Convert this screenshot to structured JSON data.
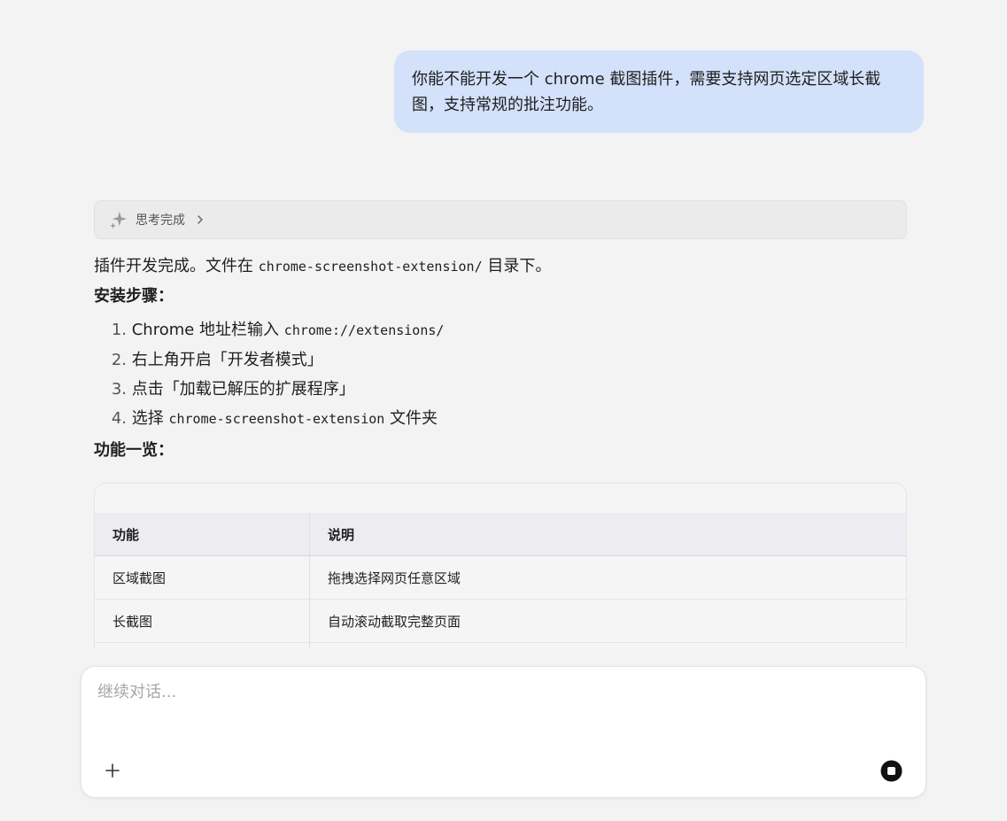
{
  "conversation": {
    "user_message": "你能不能开发一个 chrome 截图插件，需要支持网页选定区域长截图，支持常规的批注功能。",
    "assistant": {
      "thinking_label": "思考完成",
      "intro_prefix": "插件开发完成。文件在",
      "intro_code": "chrome-screenshot-extension/",
      "intro_suffix": "目录下。",
      "install_heading": "安装步骤：",
      "steps": [
        {
          "num": "1.",
          "text": "Chrome 地址栏输入",
          "code": "chrome://extensions/",
          "after": ""
        },
        {
          "num": "2.",
          "text": "右上角开启「开发者模式」",
          "code": "",
          "after": ""
        },
        {
          "num": "3.",
          "text": "点击「加载已解压的扩展程序」",
          "code": "",
          "after": ""
        },
        {
          "num": "4.",
          "text": "选择",
          "code": "chrome-screenshot-extension",
          "after": "文件夹"
        }
      ],
      "features_heading": "功能一览：",
      "table": {
        "headers": [
          "功能",
          "说明"
        ],
        "rows": [
          [
            "区域截图",
            "拖拽选择网页任意区域"
          ],
          [
            "长截图",
            "自动滚动截取完整页面"
          ]
        ]
      }
    }
  },
  "composer": {
    "placeholder": "继续对话..."
  },
  "colors": {
    "user_bubble": "#d3e1fa",
    "background": "#f3f3f3"
  },
  "icons": {
    "thinking": "sparkle-icon",
    "expand": "chevron-right-icon",
    "add": "plus-icon",
    "stop": "stop-icon"
  }
}
